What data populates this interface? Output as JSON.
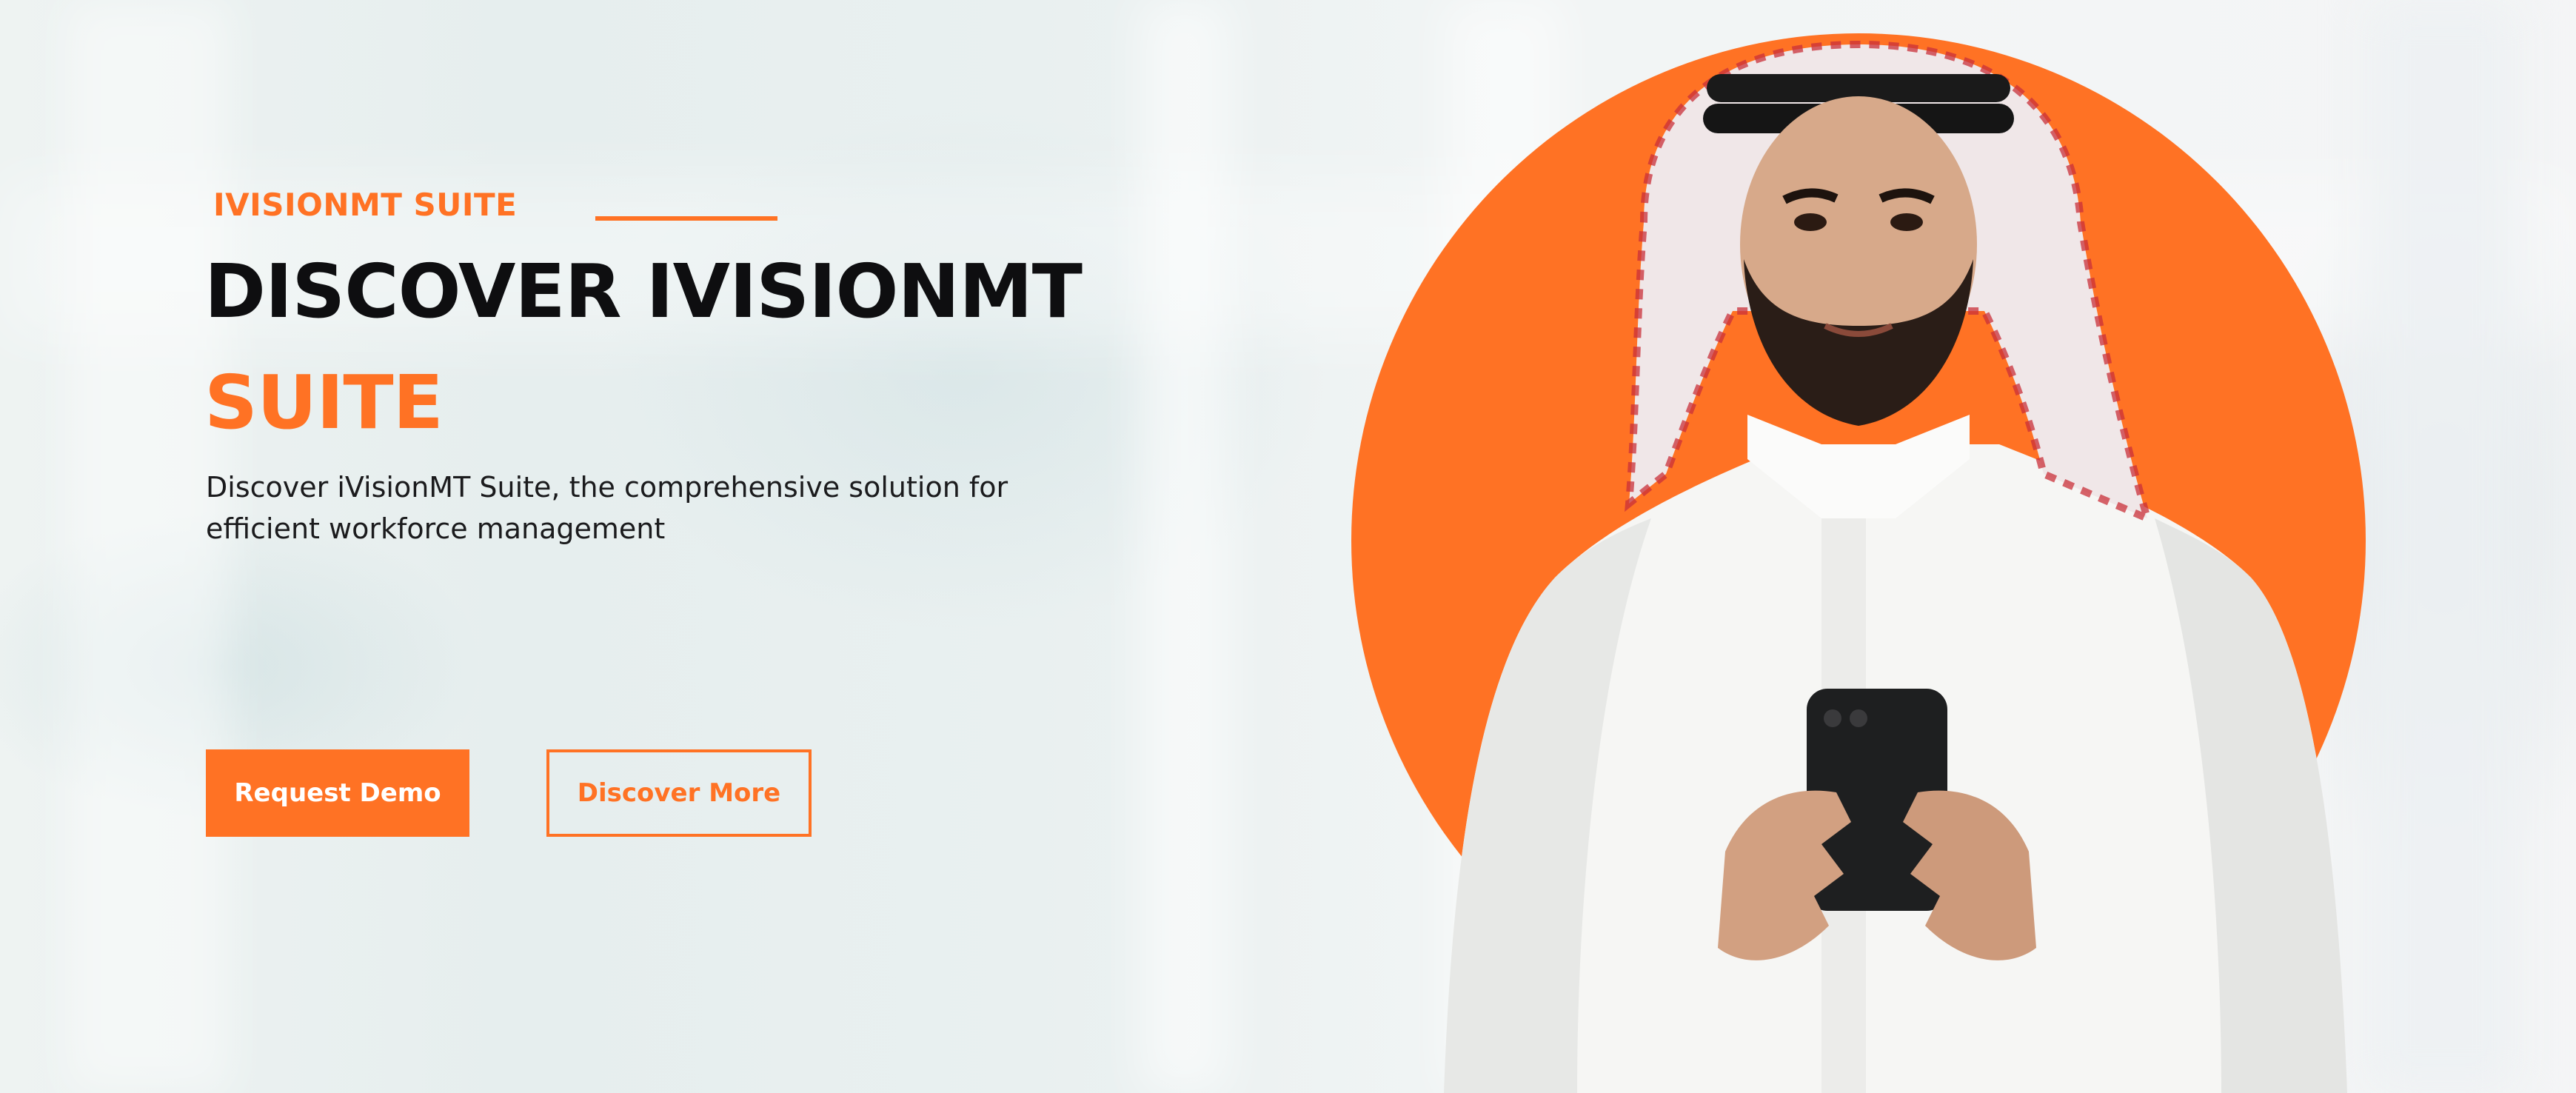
{
  "hero": {
    "eyebrow": "IVISIONMT SUITE",
    "headline_line1": "DISCOVER IVISIONMT",
    "headline_line2": "SUITE",
    "subtitle": "Discover iVisionMT Suite, the comprehensive solution for efficient workforce management"
  },
  "actions": {
    "primary_label": "Request Demo",
    "secondary_label": "Discover More"
  },
  "colors": {
    "accent": "#ff7224",
    "headline": "#0e0e10",
    "body_text": "#1b1b1d"
  }
}
